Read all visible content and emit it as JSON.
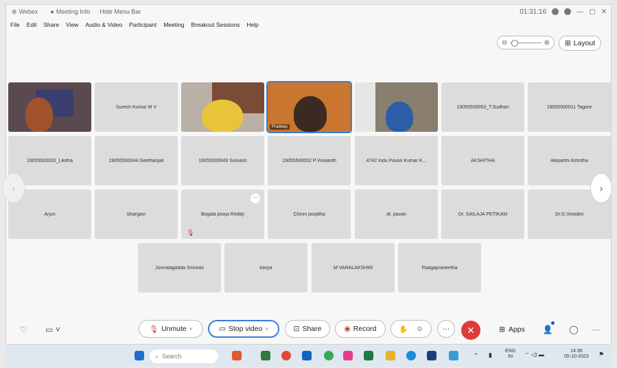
{
  "titlebar": {
    "app": "Webex",
    "meeting_info": "Meeting Info",
    "hide_menu": "Hide Menu Bar",
    "timer": "01:31:16"
  },
  "menu": [
    "File",
    "Edit",
    "Share",
    "View",
    "Audio & Video",
    "Participant",
    "Meeting",
    "Breakout Sessions",
    "Help"
  ],
  "layout_button": "Layout",
  "participants_row1": [
    "Suresh Kumar M V",
    "19055500053_T.Sudhari",
    "19055500011 Tagore"
  ],
  "video_tiles": {
    "active_label": "Pradeep"
  },
  "participants_row2": [
    "19055500032_Likitha",
    "19055500044 Geethanjali",
    "19055500049 Sumasri",
    "19055500052 P.Viswanth",
    "4742 Indu Pavan Kumar K...",
    "AKSHITHA",
    "Aleparthi Ashritha"
  ],
  "participants_row3": [
    "Arjun",
    "bhargavi",
    "Bogala pooja Reddy",
    "Chinni poojitha",
    "dr. pavan",
    "Dr. SAILAJA PETIKAM",
    "Dr.G.Vinodini"
  ],
  "participants_row4": [
    "Jonnalagadda Srinivas",
    "kavya",
    "M VARALAKSHMI",
    "Raagapraneetha"
  ],
  "controls": {
    "unmute": "Unmute",
    "stop_video": "Stop video",
    "share": "Share",
    "record": "Record",
    "apps": "Apps"
  },
  "taskbar": {
    "search_placeholder": "Search",
    "lang_line1": "ENG",
    "lang_line2": "IN",
    "time": "14:36",
    "date": "05-10-2023"
  }
}
